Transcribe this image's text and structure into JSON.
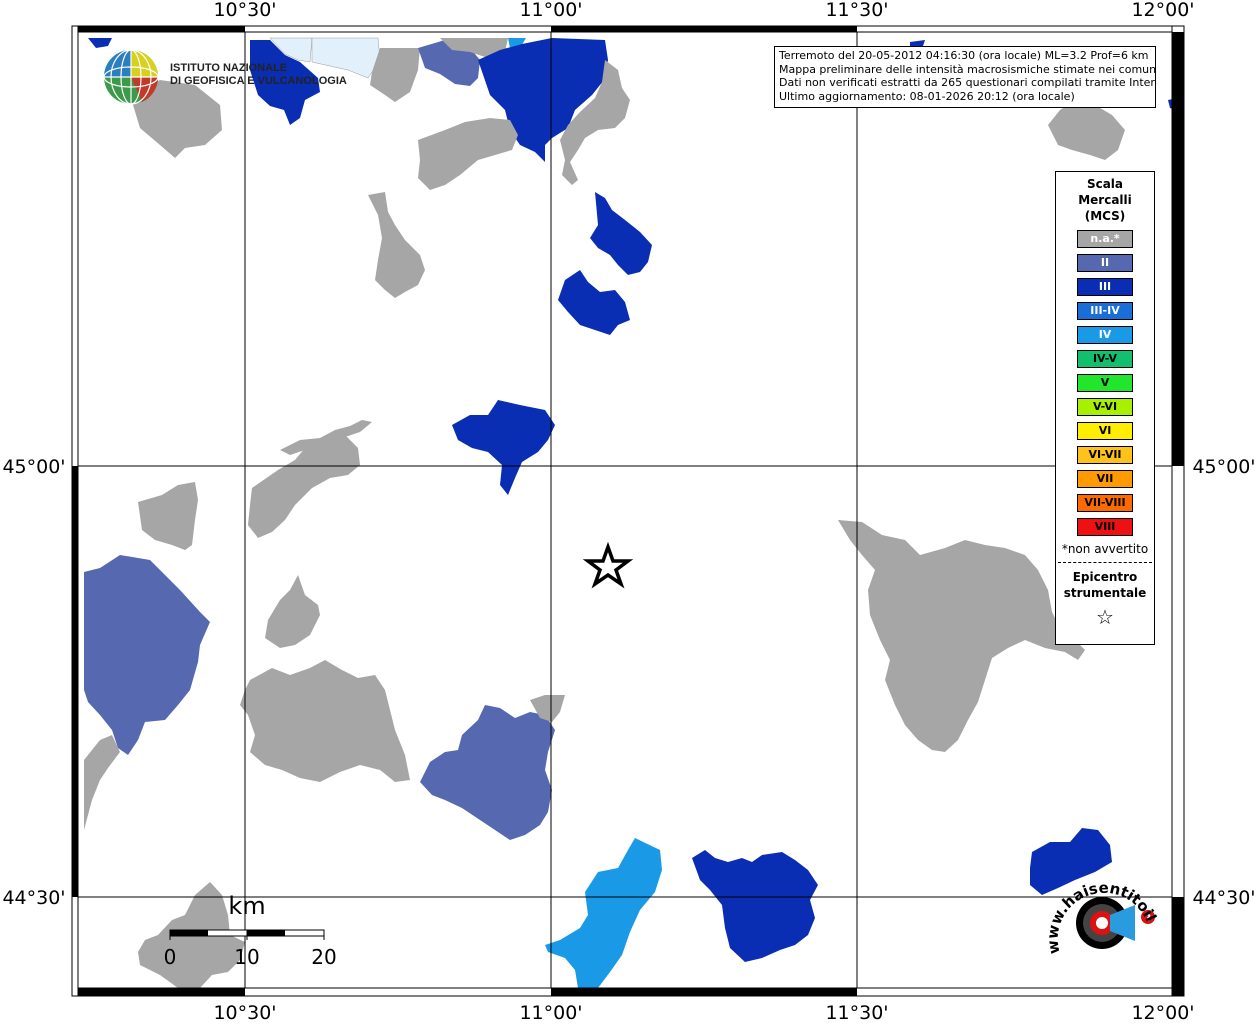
{
  "map": {
    "axes": {
      "lon_labels": [
        "10°30'",
        "11°00'",
        "11°30'",
        "12°00'"
      ],
      "lat_labels": [
        "45°00'",
        "44°30'"
      ]
    },
    "info_lines": [
      "Terremoto del 20-05-2012 04:16:30 (ora locale) ML=3.2 Prof=6 km",
      "Mappa preliminare delle intensità macrosismiche stimate nei comuni",
      "Dati non verificati estratti da 265 questionari compilati tramite Internet.",
      "Ultimo aggiornamento: 08-01-2026 20:12 (ora locale)"
    ],
    "legend": {
      "title_line1": "Scala",
      "title_line2": "Mercalli",
      "title_line3": "(MCS)",
      "items": [
        {
          "label": "n.a.*",
          "color": "#a6a6a6",
          "text_color": "#ffffff"
        },
        {
          "label": "II",
          "color": "#5568b0",
          "text_color": "#ffffff"
        },
        {
          "label": "III",
          "color": "#0a2eb3",
          "text_color": "#ffffff"
        },
        {
          "label": "III-IV",
          "color": "#1a6ed6",
          "text_color": "#ffffff"
        },
        {
          "label": "IV",
          "color": "#1a9ae6",
          "text_color": "#ffffff"
        },
        {
          "label": "IV-V",
          "color": "#11bf6e",
          "text_color": "#000000"
        },
        {
          "label": "V",
          "color": "#22e62c",
          "text_color": "#000000"
        },
        {
          "label": "V-VI",
          "color": "#a6f000",
          "text_color": "#000000"
        },
        {
          "label": "VI",
          "color": "#ffee00",
          "text_color": "#000000"
        },
        {
          "label": "VI-VII",
          "color": "#ffc21a",
          "text_color": "#000000"
        },
        {
          "label": "VII",
          "color": "#ff9a00",
          "text_color": "#000000"
        },
        {
          "label": "VII-VIII",
          "color": "#ff6a00",
          "text_color": "#000000"
        },
        {
          "label": "VIII",
          "color": "#ee1111",
          "text_color": "#000000"
        }
      ],
      "note": "*non avvertito",
      "epicenter_line1": "Epicentro",
      "epicenter_line2": "strumentale",
      "epicenter_symbol": "☆"
    },
    "scale_bar": {
      "unit": "km",
      "labels": [
        "0",
        "10",
        "20"
      ]
    },
    "logo_ingv": {
      "line1": "ISTITUTO NAZIONALE",
      "line2": "DI GEOFISICA E VULCANOLOGIA"
    },
    "logo_hai": {
      "text": "www.haisentitoilterremoto.it",
      "question": "?"
    },
    "colors": {
      "gray": "#a6a6a6",
      "ii": "#5568b0",
      "iii": "#0a2eb3",
      "iv": "#1a9ae6",
      "light": "#e2f0fb"
    }
  }
}
